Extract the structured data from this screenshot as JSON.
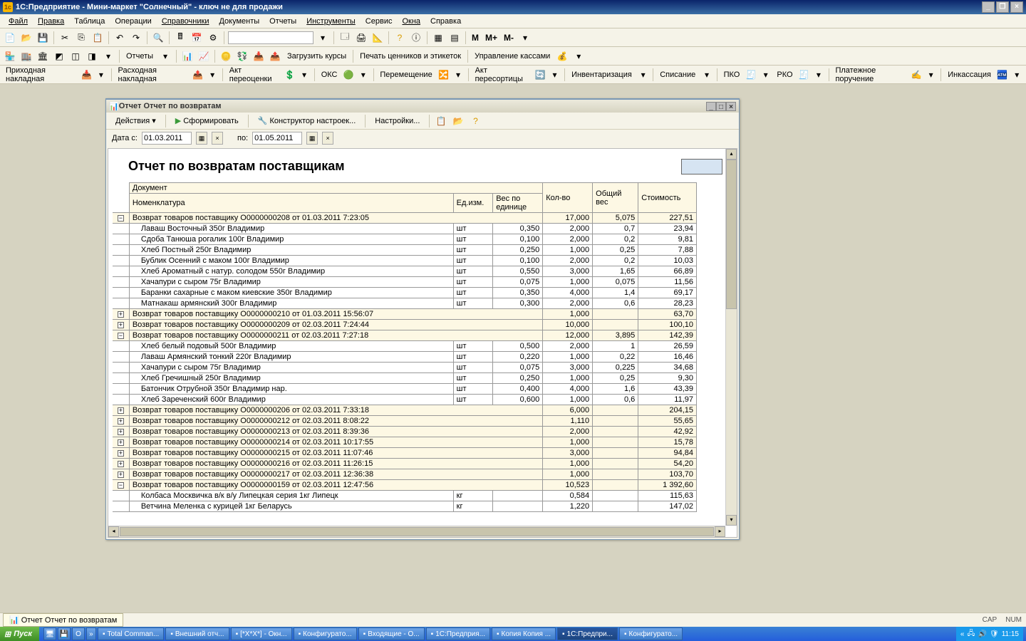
{
  "app_title": "1С:Предприятие - Мини-маркет \"Солнечный\" - ключ не для продажи",
  "menu": [
    "Файл",
    "Правка",
    "Таблица",
    "Операции",
    "Справочники",
    "Документы",
    "Отчеты",
    "Инструменты",
    "Сервис",
    "Окна",
    "Справка"
  ],
  "toolbar3": {
    "reports": "Отчеты",
    "load_rates": "Загрузить курсы",
    "print_labels": "Печать ценников и этикеток",
    "cash_mgmt": "Управление кассами"
  },
  "toolbar4": {
    "in_invoice": "Приходная накладная",
    "out_invoice": "Расходная накладная",
    "revaluation": "Акт переоценки",
    "oks": "ОКС",
    "transfer": "Перемещение",
    "resort": "Акт пересортицы",
    "inventory": "Инвентаризация",
    "writeoff": "Списание",
    "pko": "ПКО",
    "rko": "РКО",
    "payment": "Платежное поручение",
    "inkass": "Инкассация"
  },
  "child": {
    "title": "Отчет  Отчет по возвратам",
    "actions": "Действия",
    "form": "Сформировать",
    "ctor": "Конструктор настроек...",
    "settings": "Настройки...",
    "date_from_lbl": "Дата с:",
    "date_to_lbl": "по:",
    "date_from": "01.03.2011",
    "date_to": "01.05.2011"
  },
  "report": {
    "title": "Отчет по возвратам поставщикам",
    "headers": {
      "doc": "Документ",
      "nomen": "Номенклатура",
      "unit": "Ед.изм.",
      "weight_unit": "Вес по единице",
      "qty": "Кол-во",
      "total_weight": "Общий вес",
      "cost": "Стоимость"
    },
    "groups": [
      {
        "expanded": true,
        "title": "Возврат товаров поставщику О0000000208 от 01.03.2011 7:23:05",
        "qty": "17,000",
        "w": "5,075",
        "cost": "227,51",
        "rows": [
          {
            "n": "Лаваш Восточный 350г Владимир",
            "u": "шт",
            "wu": "0,350",
            "q": "2,000",
            "w": "0,7",
            "c": "23,94"
          },
          {
            "n": "Сдоба Танюша рогалик 100г Владимир",
            "u": "шт",
            "wu": "0,100",
            "q": "2,000",
            "w": "0,2",
            "c": "9,81"
          },
          {
            "n": "Хлеб Постный 250г Владимир",
            "u": "шт",
            "wu": "0,250",
            "q": "1,000",
            "w": "0,25",
            "c": "7,88"
          },
          {
            "n": "Бублик Осенний с маком 100г Владимир",
            "u": "шт",
            "wu": "0,100",
            "q": "2,000",
            "w": "0,2",
            "c": "10,03"
          },
          {
            "n": "Хлеб Ароматный с натур. солодом 550г Владимир",
            "u": "шт",
            "wu": "0,550",
            "q": "3,000",
            "w": "1,65",
            "c": "66,89"
          },
          {
            "n": "Хачапури с сыром 75г Владимир",
            "u": "шт",
            "wu": "0,075",
            "q": "1,000",
            "w": "0,075",
            "c": "11,56"
          },
          {
            "n": "Баранки сахарные с маком киевские 350г Владимир",
            "u": "шт",
            "wu": "0,350",
            "q": "4,000",
            "w": "1,4",
            "c": "69,17"
          },
          {
            "n": "Матнакаш армянский  300г Владимир",
            "u": "шт",
            "wu": "0,300",
            "q": "2,000",
            "w": "0,6",
            "c": "28,23"
          }
        ]
      },
      {
        "expanded": false,
        "title": "Возврат товаров поставщику О0000000210 от 01.03.2011 15:56:07",
        "qty": "1,000",
        "w": "",
        "cost": "63,70"
      },
      {
        "expanded": false,
        "title": "Возврат товаров поставщику О0000000209 от 02.03.2011 7:24:44",
        "qty": "10,000",
        "w": "",
        "cost": "100,10"
      },
      {
        "expanded": true,
        "title": "Возврат товаров поставщику О0000000211 от 02.03.2011 7:27:18",
        "qty": "12,000",
        "w": "3,895",
        "cost": "142,39",
        "rows": [
          {
            "n": "Хлеб белый подовый 500г Владимир",
            "u": "шт",
            "wu": "0,500",
            "q": "2,000",
            "w": "1",
            "c": "26,59"
          },
          {
            "n": "Лаваш Армянский тонкий 220г Владимир",
            "u": "шт",
            "wu": "0,220",
            "q": "1,000",
            "w": "0,22",
            "c": "16,46"
          },
          {
            "n": "Хачапури с сыром 75г Владимир",
            "u": "шт",
            "wu": "0,075",
            "q": "3,000",
            "w": "0,225",
            "c": "34,68"
          },
          {
            "n": "Хлеб Гречишный 250г Владимир",
            "u": "шт",
            "wu": "0,250",
            "q": "1,000",
            "w": "0,25",
            "c": "9,30"
          },
          {
            "n": "Батончик Отрубной 350г Владимир нар.",
            "u": "шт",
            "wu": "0,400",
            "q": "4,000",
            "w": "1,6",
            "c": "43,39"
          },
          {
            "n": "Хлеб Зареченский 600г Владимир",
            "u": "шт",
            "wu": "0,600",
            "q": "1,000",
            "w": "0,6",
            "c": "11,97"
          }
        ]
      },
      {
        "expanded": false,
        "title": "Возврат товаров поставщику О0000000206 от 02.03.2011 7:33:18",
        "qty": "6,000",
        "w": "",
        "cost": "204,15"
      },
      {
        "expanded": false,
        "title": "Возврат товаров поставщику О0000000212 от 02.03.2011 8:08:22",
        "qty": "1,110",
        "w": "",
        "cost": "55,65"
      },
      {
        "expanded": false,
        "title": "Возврат товаров поставщику О0000000213 от 02.03.2011 8:39:36",
        "qty": "2,000",
        "w": "",
        "cost": "42,92"
      },
      {
        "expanded": false,
        "title": "Возврат товаров поставщику О0000000214 от 02.03.2011 10:17:55",
        "qty": "1,000",
        "w": "",
        "cost": "15,78"
      },
      {
        "expanded": false,
        "title": "Возврат товаров поставщику О0000000215 от 02.03.2011 11:07:46",
        "qty": "3,000",
        "w": "",
        "cost": "94,84"
      },
      {
        "expanded": false,
        "title": "Возврат товаров поставщику О0000000216 от 02.03.2011 11:26:15",
        "qty": "1,000",
        "w": "",
        "cost": "54,20"
      },
      {
        "expanded": false,
        "title": "Возврат товаров поставщику О0000000217 от 02.03.2011 12:36:38",
        "qty": "1,000",
        "w": "",
        "cost": "103,70"
      },
      {
        "expanded": true,
        "title": "Возврат товаров поставщику О0000000159 от 02.03.2011 12:47:56",
        "qty": "10,523",
        "w": "",
        "cost": "1 392,60",
        "rows": [
          {
            "n": "Колбаса Москвичка в/к в/у Липецкая серия 1кг Липецк",
            "u": "кг",
            "wu": "",
            "q": "0,584",
            "w": "",
            "c": "115,63"
          },
          {
            "n": "Ветчина Меленка с курицей 1кг Беларусь",
            "u": "кг",
            "wu": "",
            "q": "1,220",
            "w": "",
            "c": "147,02"
          }
        ]
      }
    ]
  },
  "windowbar_item": "Отчет  Отчет по возвратам",
  "status": {
    "cap": "CAP",
    "num": "NUM"
  },
  "taskbar": {
    "start": "Пуск",
    "items": [
      "Total Comman...",
      "Внешний отч...",
      "[*X*X*] - Окн...",
      "Конфигурато...",
      "Входящие - O...",
      "1С:Предприя...",
      "Копия Копия ...",
      "1С:Предпри...",
      "Конфигурато..."
    ],
    "active_index": 7,
    "time": "11:15"
  }
}
